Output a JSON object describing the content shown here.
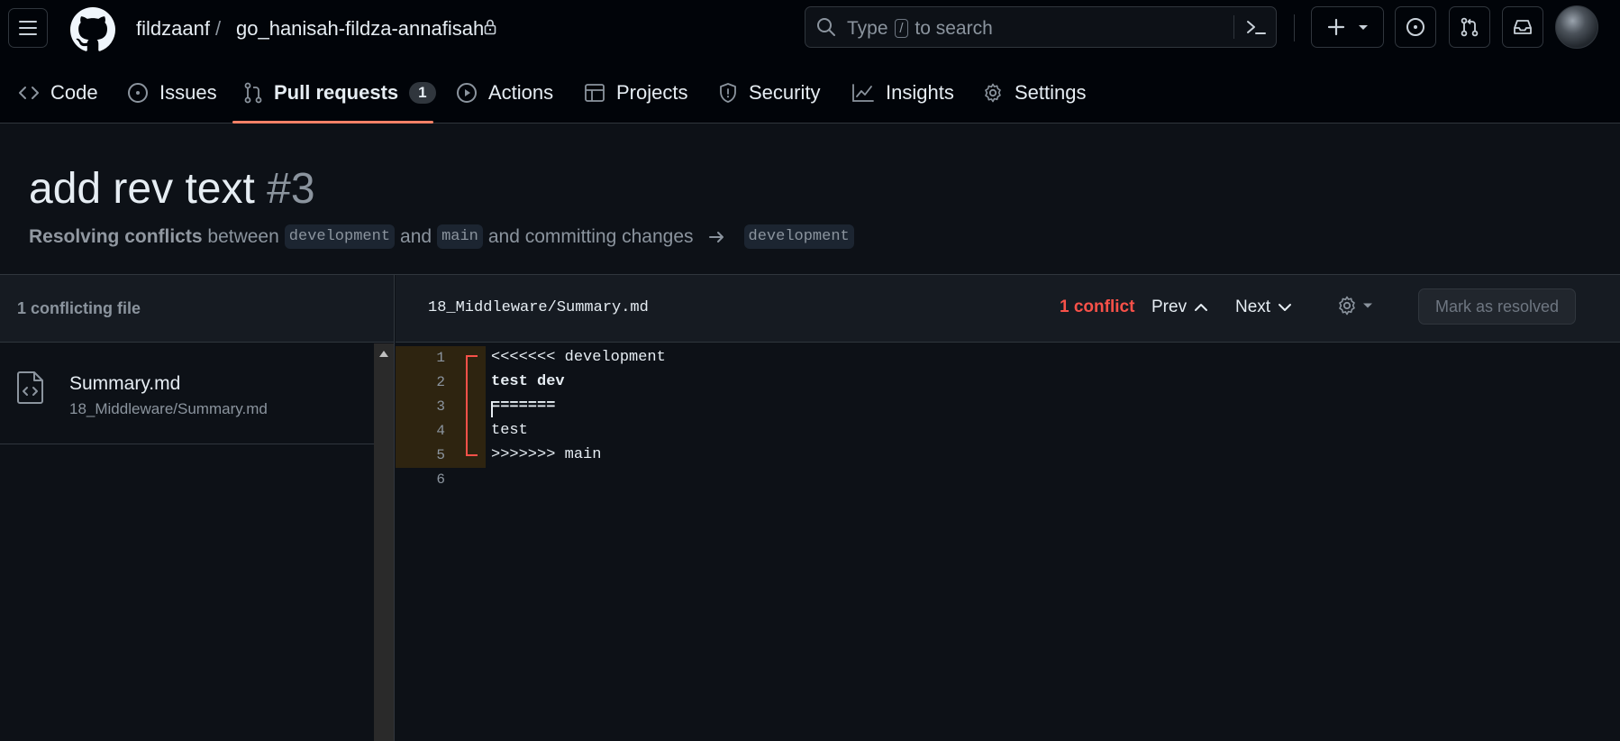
{
  "header": {
    "owner": "fildzaanf",
    "separator": "/",
    "repo": "go_hanisah-fildza-annafisah",
    "search": {
      "pre": "Type",
      "key": "/",
      "post": "to search"
    }
  },
  "tabs": [
    {
      "label": "Code",
      "icon": "code-icon"
    },
    {
      "label": "Issues",
      "icon": "issue-icon"
    },
    {
      "label": "Pull requests",
      "icon": "pull-request-icon",
      "count": "1",
      "active": true
    },
    {
      "label": "Actions",
      "icon": "play-icon"
    },
    {
      "label": "Projects",
      "icon": "table-icon"
    },
    {
      "label": "Security",
      "icon": "shield-icon"
    },
    {
      "label": "Insights",
      "icon": "graph-icon"
    },
    {
      "label": "Settings",
      "icon": "gear-icon"
    }
  ],
  "pr": {
    "title": "add rev text",
    "number": "#3",
    "subtitle": {
      "lead": "Resolving conflicts",
      "between": "between",
      "head": "development",
      "and": "and",
      "base": "main",
      "rest": "and committing changes",
      "target": "development"
    }
  },
  "sidebar": {
    "heading": "1 conflicting file",
    "file": {
      "name": "Summary.md",
      "path": "18_Middleware/Summary.md"
    }
  },
  "editor": {
    "path": "18_Middleware/Summary.md",
    "conflicts": "1 conflict",
    "prev": "Prev",
    "next": "Next",
    "resolve": "Mark as resolved",
    "lines": [
      {
        "n": "1",
        "text": "<<<<<<< development"
      },
      {
        "n": "2",
        "text": "test dev"
      },
      {
        "n": "3",
        "text": "======="
      },
      {
        "n": "4",
        "text": "test"
      },
      {
        "n": "5",
        "text": ">>>>>>> main"
      },
      {
        "n": "6",
        "text": ""
      }
    ]
  },
  "colors": {
    "accent_tab": "#f78166",
    "conflict": "#f85149",
    "bg": "#0d1117"
  }
}
